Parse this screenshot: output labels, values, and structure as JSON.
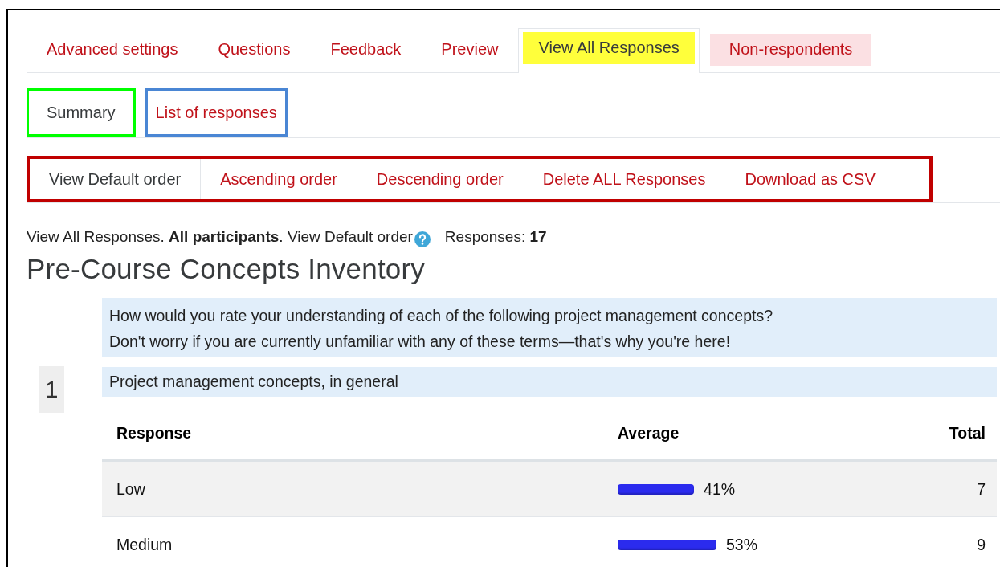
{
  "tabs": [
    {
      "label": "Advanced settings",
      "selected": false
    },
    {
      "label": "Questions",
      "selected": false
    },
    {
      "label": "Feedback",
      "selected": false
    },
    {
      "label": "Preview",
      "selected": false
    },
    {
      "label": "View All Responses",
      "selected": true,
      "color": "#ffff3b"
    },
    {
      "label": "Non-respondents",
      "selected": false,
      "color": "#fbe0e3"
    }
  ],
  "subtabs": [
    {
      "label": "Summary",
      "selected": true,
      "color": "#00ff00"
    },
    {
      "label": "List of responses",
      "selected": false,
      "color": "#4a86d4"
    }
  ],
  "order_bar": [
    {
      "label": "View Default order",
      "selected": true
    },
    {
      "label": "Ascending order",
      "selected": false
    },
    {
      "label": "Descending order",
      "selected": false
    },
    {
      "label": "Delete ALL Responses",
      "selected": false
    },
    {
      "label": "Download as CSV",
      "selected": false
    }
  ],
  "info": {
    "text": "View All Responses. **All participants**. View Default order",
    "responses": "Responses: **17**"
  },
  "title": "Pre-Course Concepts Inventory",
  "question": {
    "number": "1",
    "intro": [
      "How would you rate your understanding of each of the following project management concepts?",
      "Don't worry if you are currently unfamiliar with any of these terms—that's why you're here!"
    ],
    "item": "Project management concepts, in general"
  },
  "table": {
    "columns": [
      "Response",
      "Average",
      "Total"
    ],
    "rows": [
      {
        "response": "Low",
        "average": "41%",
        "total": "7"
      },
      {
        "response": "Medium",
        "average": "53%",
        "total": "9"
      }
    ]
  }
}
